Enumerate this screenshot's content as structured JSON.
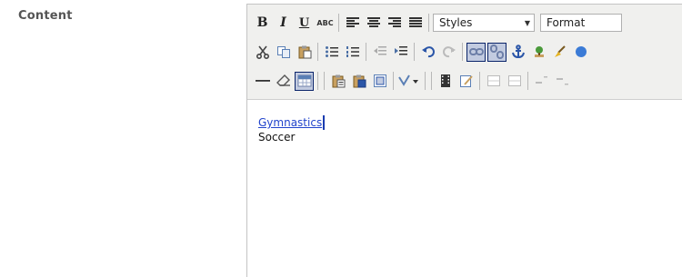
{
  "field": {
    "label": "Content"
  },
  "toolbar": {
    "bold_label": "B",
    "italic_label": "I",
    "underline_label": "U",
    "strikethrough_label": "ABC",
    "styles_select": {
      "selected": "Styles"
    },
    "format_select": {
      "selected": "Format"
    }
  },
  "content": {
    "items": [
      "Gymnastics",
      "Soccer"
    ]
  },
  "colors": {
    "link": "#2244cc",
    "toolbar_bg": "#f0f0ee",
    "active_button": "#c2cbe0"
  }
}
